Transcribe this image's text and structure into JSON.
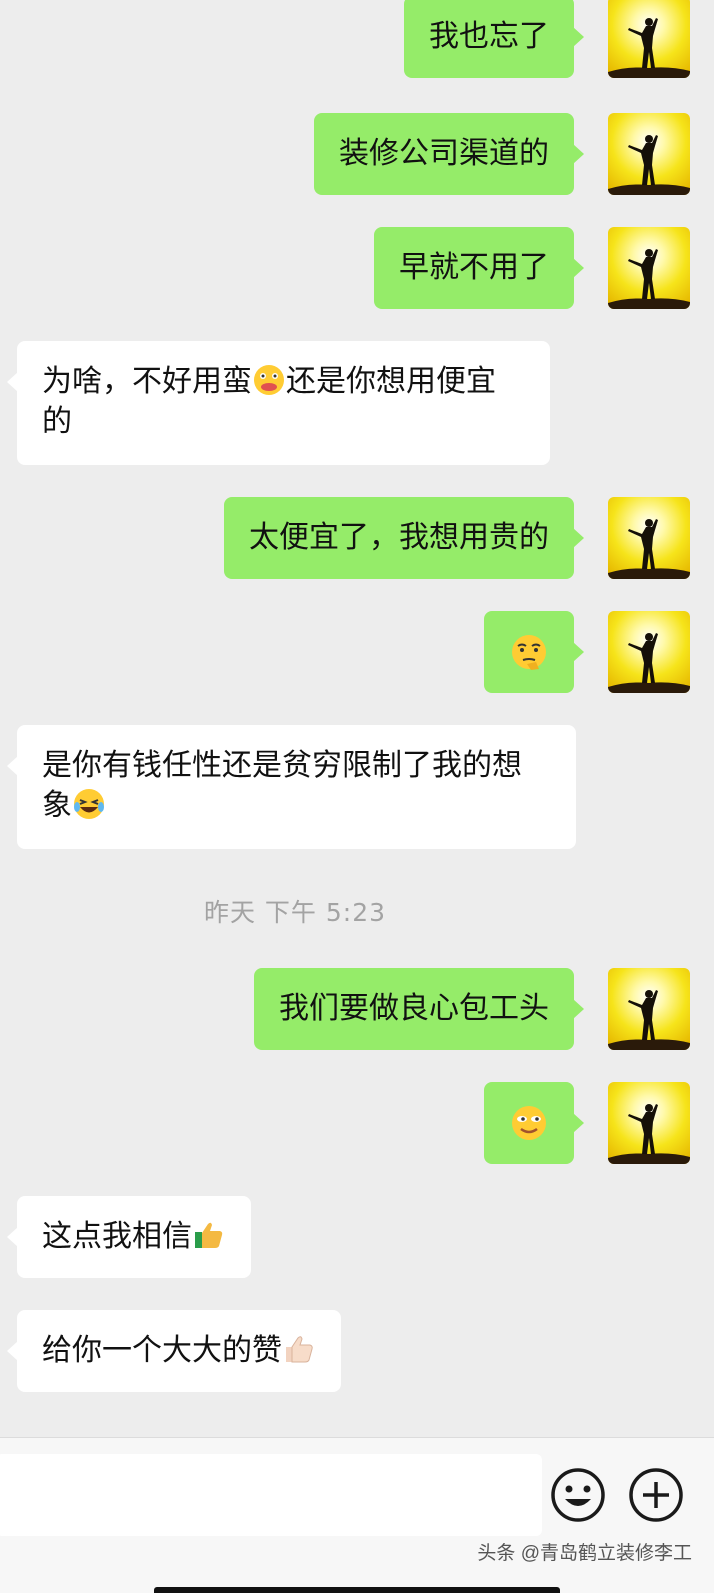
{
  "messages": [
    {
      "side": "sent",
      "text": "我也忘了"
    },
    {
      "side": "sent",
      "text": "装修公司渠道的"
    },
    {
      "side": "sent",
      "text": "早就不用了"
    },
    {
      "side": "recv",
      "text_a": "为啥，不好用蛮",
      "emoji": "grimace-emoji",
      "text_b": "还是你想用便宜的"
    },
    {
      "side": "sent",
      "text": "太便宜了，我想用贵的"
    },
    {
      "side": "sent",
      "emoji": "thinking-emoji"
    },
    {
      "side": "recv",
      "text": "是你有钱任性还是贫穷限制了我的想象",
      "emoji": "laughing-tears-emoji"
    },
    {
      "side": "sent",
      "text": "我们要做良心包工头"
    },
    {
      "side": "sent",
      "emoji": "smug-smile-emoji"
    },
    {
      "side": "recv",
      "text": "这点我相信",
      "emoji": "thumbs-up-emoji"
    },
    {
      "side": "recv",
      "text": "给你一个大大的赞",
      "emoji": "thumbs-up-light-emoji"
    }
  ],
  "timestamp": "昨天 下午 5:23",
  "input": {
    "value": "",
    "emoji_button": "smiley-face-icon",
    "more_button": "plus-circle-icon"
  },
  "watermark": "头条 @青岛鹤立装修李工",
  "colors": {
    "sent_bubble": "#95ec69",
    "recv_bubble": "#ffffff",
    "background": "#ededed"
  }
}
